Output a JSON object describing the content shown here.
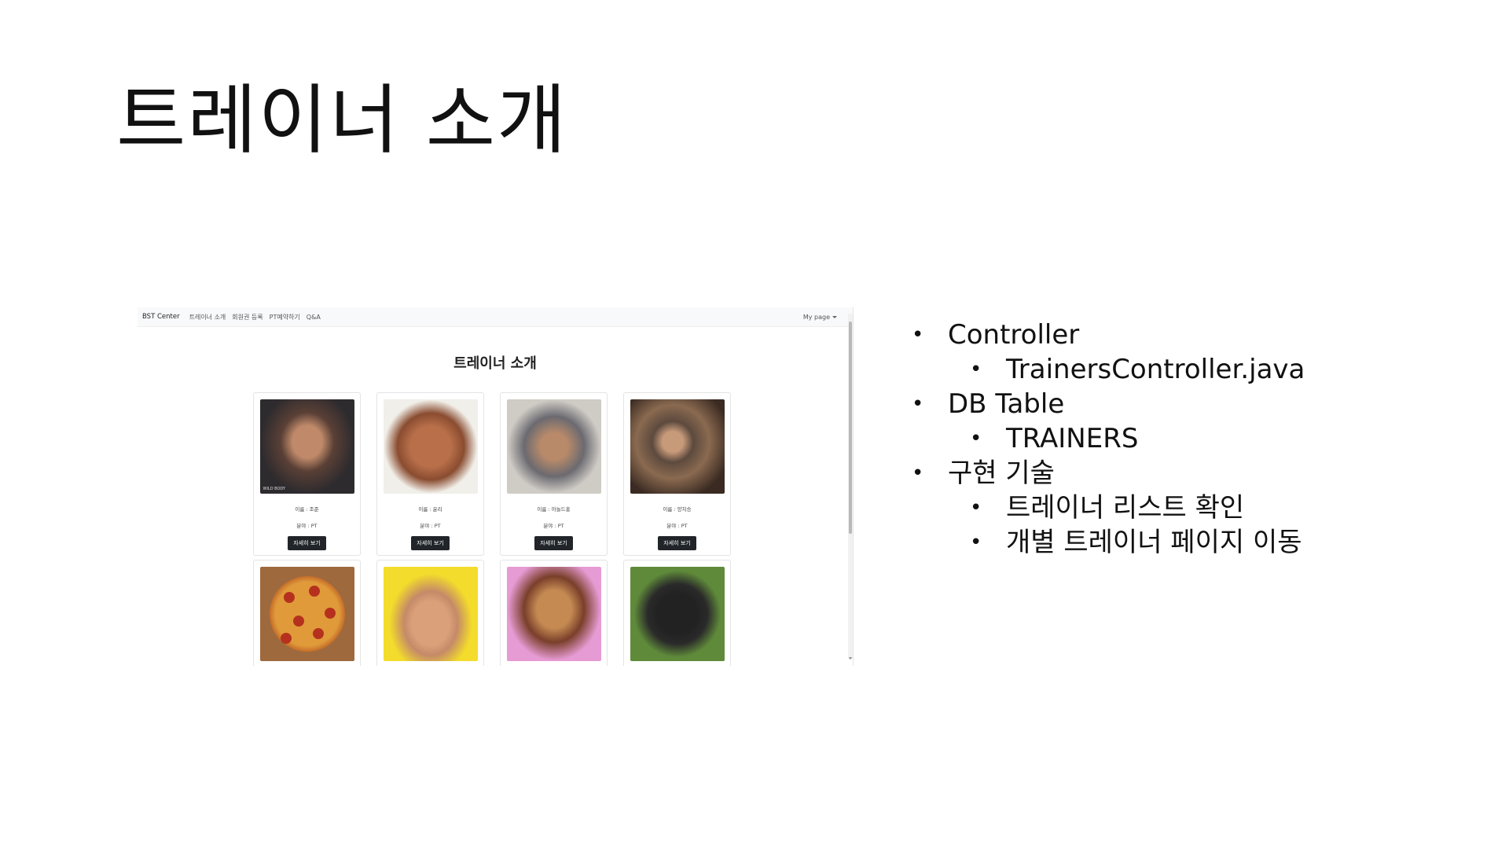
{
  "slide": {
    "title": "트레이너 소개",
    "bullets": [
      {
        "level": 1,
        "text": "Controller"
      },
      {
        "level": 2,
        "text": "TrainersController.java"
      },
      {
        "level": 1,
        "text": "DB Table"
      },
      {
        "level": 2,
        "text": "TRAINERS"
      },
      {
        "level": 1,
        "text": "구현 기술"
      },
      {
        "level": 2,
        "text": "트레이너 리스트 확인"
      },
      {
        "level": 2,
        "text": "개별 트레이너 페이지 이동"
      }
    ]
  },
  "browser": {
    "nav": {
      "brand": "BST Center",
      "links": [
        "트레이너 소개",
        "회원권 등록",
        "PT예약하기",
        "Q&A"
      ],
      "mypage": "My page"
    },
    "heading": "트레이너 소개",
    "trainers": [
      {
        "name": "이름 : 조준",
        "field": "분야 : PT",
        "button": "자세히 보기",
        "photo": "muscle-man-photo",
        "watermark": "WILD BODY"
      },
      {
        "name": "이름 : 윤리",
        "field": "분야 : PT",
        "button": "자세히 보기",
        "photo": "bodybuilder-photo"
      },
      {
        "name": "이름 : 아놀드홍",
        "field": "분야 : PT",
        "button": "자세히 보기",
        "photo": "chair-man-photo"
      },
      {
        "name": "이름 : 양치승",
        "field": "분야 : PT",
        "button": "자세히 보기",
        "photo": "plaid-shirt-man-photo"
      }
    ],
    "trainers_row2": [
      {
        "photo": "pizza-photo"
      },
      {
        "photo": "yellow-bg-man-photo"
      },
      {
        "photo": "pig-character-photo"
      },
      {
        "photo": "monkey-photo"
      }
    ]
  }
}
